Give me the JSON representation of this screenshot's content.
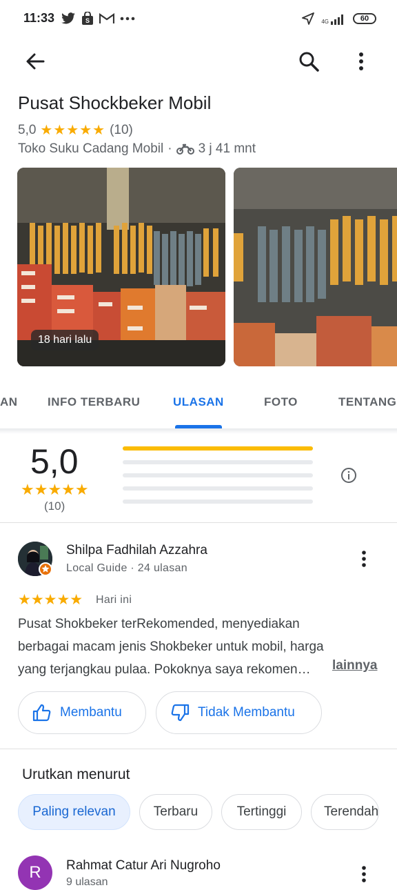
{
  "status_bar": {
    "time": "11:33",
    "network": "4G",
    "battery": "60",
    "icons": [
      "twitter-icon",
      "shop-icon",
      "gmail-icon",
      "more-dots-icon",
      "location-arrow-icon",
      "signal-icon",
      "battery-icon"
    ]
  },
  "toolbar": {
    "back_icon": "arrow-back-icon",
    "search_icon": "search-icon",
    "more_icon": "more-vert-icon"
  },
  "place": {
    "name": "Pusat Shockbeker Mobil",
    "rating": "5,0",
    "stars": "★★★★★",
    "review_count": "(10)",
    "category": "Toko Suku Cadang Mobil",
    "separator": "·",
    "travel_time": "3 j 41 mnt",
    "travel_icon": "motorcycle-icon"
  },
  "photos": {
    "badge": "18 hari lalu"
  },
  "tabs": {
    "partial_left": "AN",
    "items": [
      "INFO TERBARU",
      "ULASAN",
      "FOTO",
      "TENTANG"
    ],
    "active": "ULASAN"
  },
  "summary": {
    "score": "5,0",
    "stars": "★★★★★",
    "count": "(10)",
    "distribution": [
      1.0,
      0,
      0,
      0,
      0
    ],
    "info_icon": "info-icon"
  },
  "review1": {
    "name": "Shilpa Fadhilah Azzahra",
    "subtitle": "Local Guide · 24 ulasan",
    "stars": "★★★★★",
    "time": "Hari ini",
    "text_lines": [
      "Pusat Shokbeker terRekomended, menyediakan",
      "berbagai macam jenis Shokbeker untuk mobil, harga",
      "yang terjangkau pulaa. Pokoknya saya rekomen…"
    ],
    "more_link": "lainnya",
    "helpful_label": "Membantu",
    "not_helpful_label": "Tidak Membantu"
  },
  "sort": {
    "title": "Urutkan menurut",
    "chips": [
      "Paling relevan",
      "Terbaru",
      "Tertinggi",
      "Terendah"
    ],
    "selected": "Paling relevan"
  },
  "review2": {
    "initial": "R",
    "name": "Rahmat Catur Ari Nugroho",
    "subtitle": "9 ulasan"
  },
  "colors": {
    "accent": "#1a73e8",
    "star": "#f9ab00",
    "bar_fill": "#fbbc04",
    "chip_selected_bg": "#e8f0fe",
    "avatar2_bg": "#9334b3"
  }
}
